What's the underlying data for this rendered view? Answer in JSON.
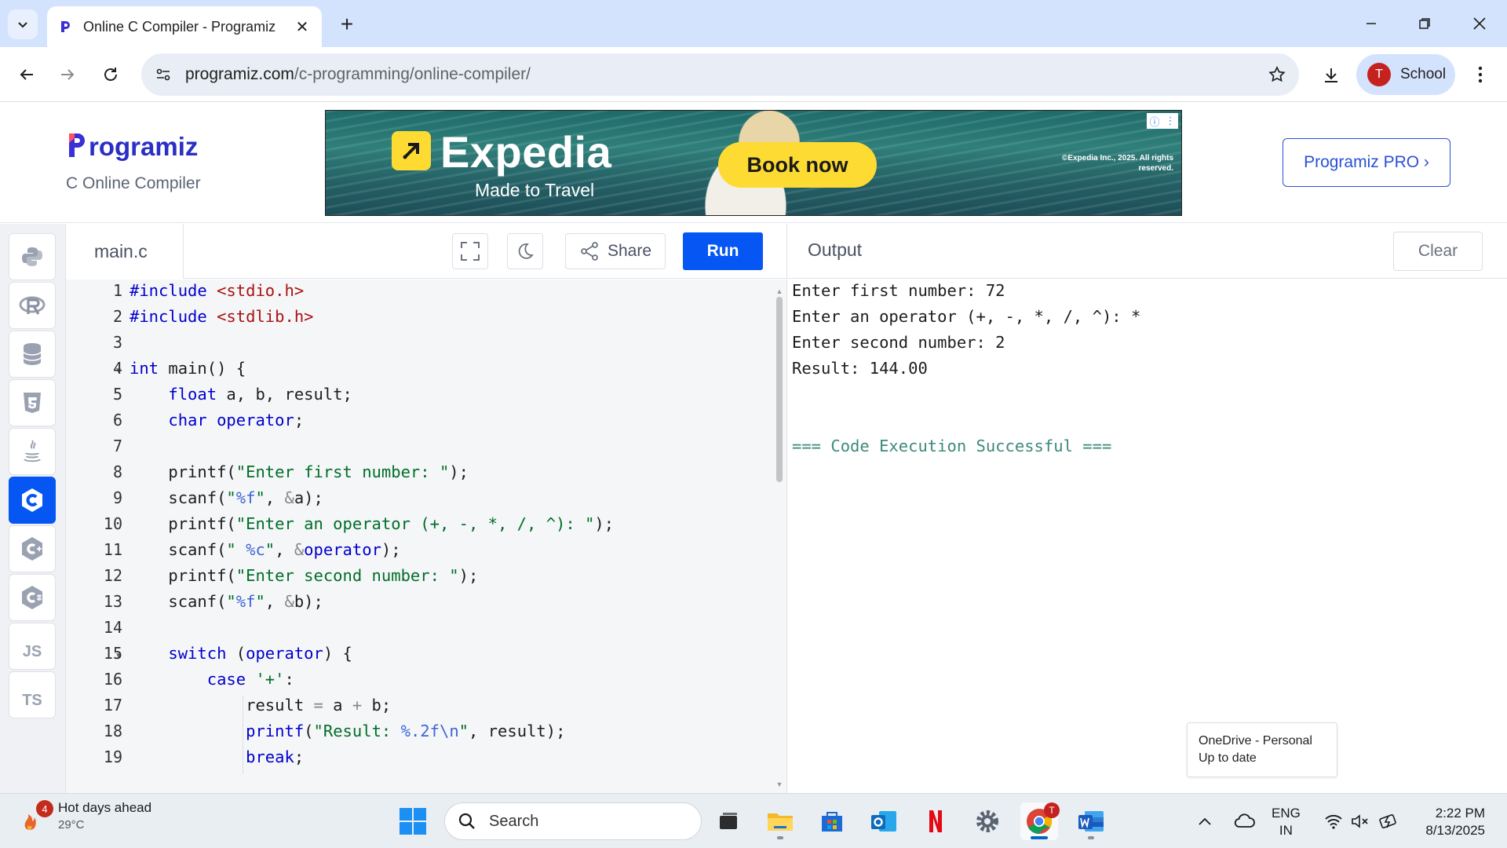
{
  "browser": {
    "tab_title": "Online C Compiler - Programiz",
    "url_host": "programiz.com",
    "url_path": "/c-programming/online-compiler/",
    "profile_initial": "T",
    "profile_name": "School"
  },
  "site": {
    "logo_text": "rogramiz",
    "subtitle": "C Online Compiler",
    "pro_button": "Programiz PRO ›"
  },
  "ad": {
    "brand": "Expedia",
    "tagline": "Made to Travel",
    "cta": "Book now",
    "copyright": "©Expedia Inc., 2025. All rights reserved."
  },
  "sidebar": {
    "items": [
      {
        "name": "python",
        "label": ""
      },
      {
        "name": "r",
        "label": ""
      },
      {
        "name": "sql",
        "label": ""
      },
      {
        "name": "html",
        "label": ""
      },
      {
        "name": "java",
        "label": ""
      },
      {
        "name": "c",
        "label": "",
        "active": true
      },
      {
        "name": "cpp",
        "label": ""
      },
      {
        "name": "csharp",
        "label": ""
      },
      {
        "name": "js",
        "label": "JS"
      },
      {
        "name": "ts",
        "label": "TS"
      }
    ]
  },
  "editor": {
    "filename": "main.c",
    "share_label": "Share",
    "run_label": "Run",
    "line_numbers": [
      "1",
      "2",
      "3",
      "4",
      "5",
      "6",
      "7",
      "8",
      "9",
      "10",
      "11",
      "12",
      "13",
      "14",
      "15",
      "16",
      "17",
      "18",
      "19"
    ]
  },
  "output": {
    "title": "Output",
    "clear_label": "Clear",
    "lines": [
      "Enter first number: 72",
      "Enter an operator (+, -, *, /, ^): *",
      "Enter second number: 2",
      "Result: 144.00",
      "",
      "",
      "=== Code Execution Successful ==="
    ]
  },
  "toast": {
    "line1": "OneDrive - Personal",
    "line2": "Up to date"
  },
  "taskbar": {
    "weather_badge": "4",
    "weather_title": "Hot days ahead",
    "weather_temp": "29°C",
    "search_placeholder": "Search",
    "chrome_badge": "T",
    "lang_line1": "ENG",
    "lang_line2": "IN",
    "time": "2:22 PM",
    "date": "8/13/2025"
  }
}
